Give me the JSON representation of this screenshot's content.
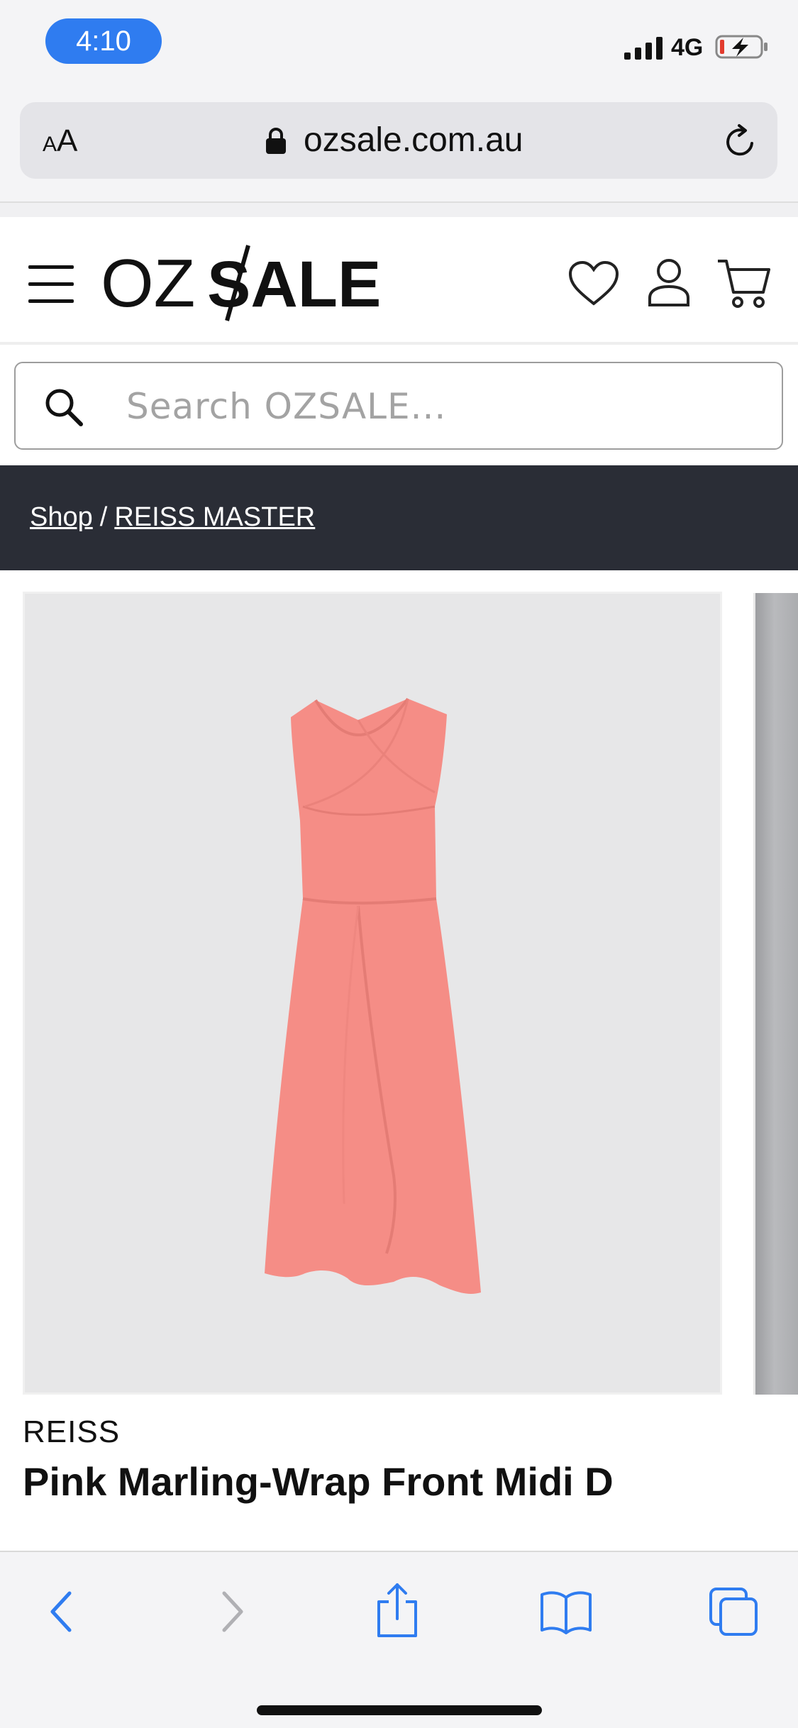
{
  "status_bar": {
    "time": "4:10",
    "network": "4G"
  },
  "browser": {
    "text_size_small": "A",
    "text_size_large": "A",
    "url": "ozsale.com.au"
  },
  "header": {
    "logo_left": "OZ",
    "logo_right": "SALE"
  },
  "search": {
    "placeholder": "Search OZSALE..."
  },
  "breadcrumb": {
    "items": [
      "Shop",
      "REISS MASTER"
    ],
    "separator": "/"
  },
  "product": {
    "brand": "REISS",
    "title": "Pink Marling-Wrap Front Midi D",
    "dress_color": "#f58d86"
  },
  "colors": {
    "accent_blue": "#2f7cf0",
    "breadcrumb_bg": "#2a2d36"
  }
}
